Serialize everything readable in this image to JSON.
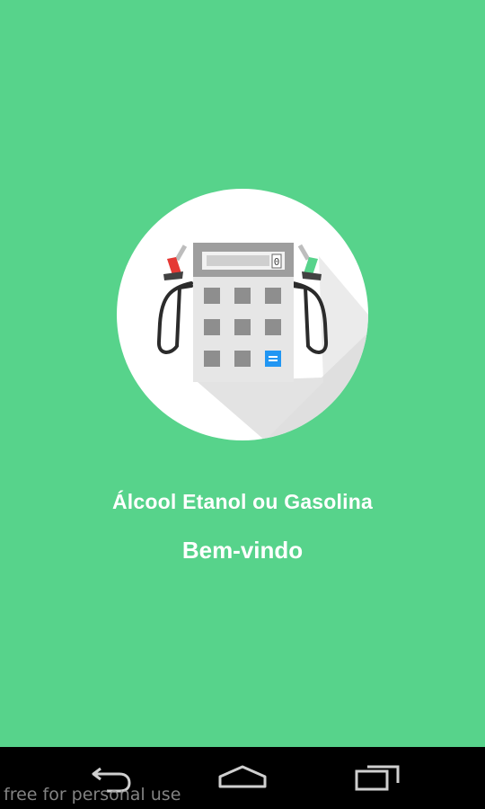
{
  "app": {
    "title": "Álcool Etanol ou Gasolina",
    "welcome": "Bem-vindo",
    "logo_icon": "fuel-pump-calculator-icon",
    "pump_display": "0"
  },
  "navigation": {
    "back_icon": "back-icon",
    "home_icon": "home-icon",
    "recents_icon": "recents-icon"
  },
  "watermark": "free for personal use",
  "colors": {
    "background": "#57d38b",
    "text": "#ffffff",
    "navbar": "#000000",
    "red_nozzle": "#e53935",
    "green_nozzle": "#57d38b",
    "enter_key": "#2196f3"
  }
}
